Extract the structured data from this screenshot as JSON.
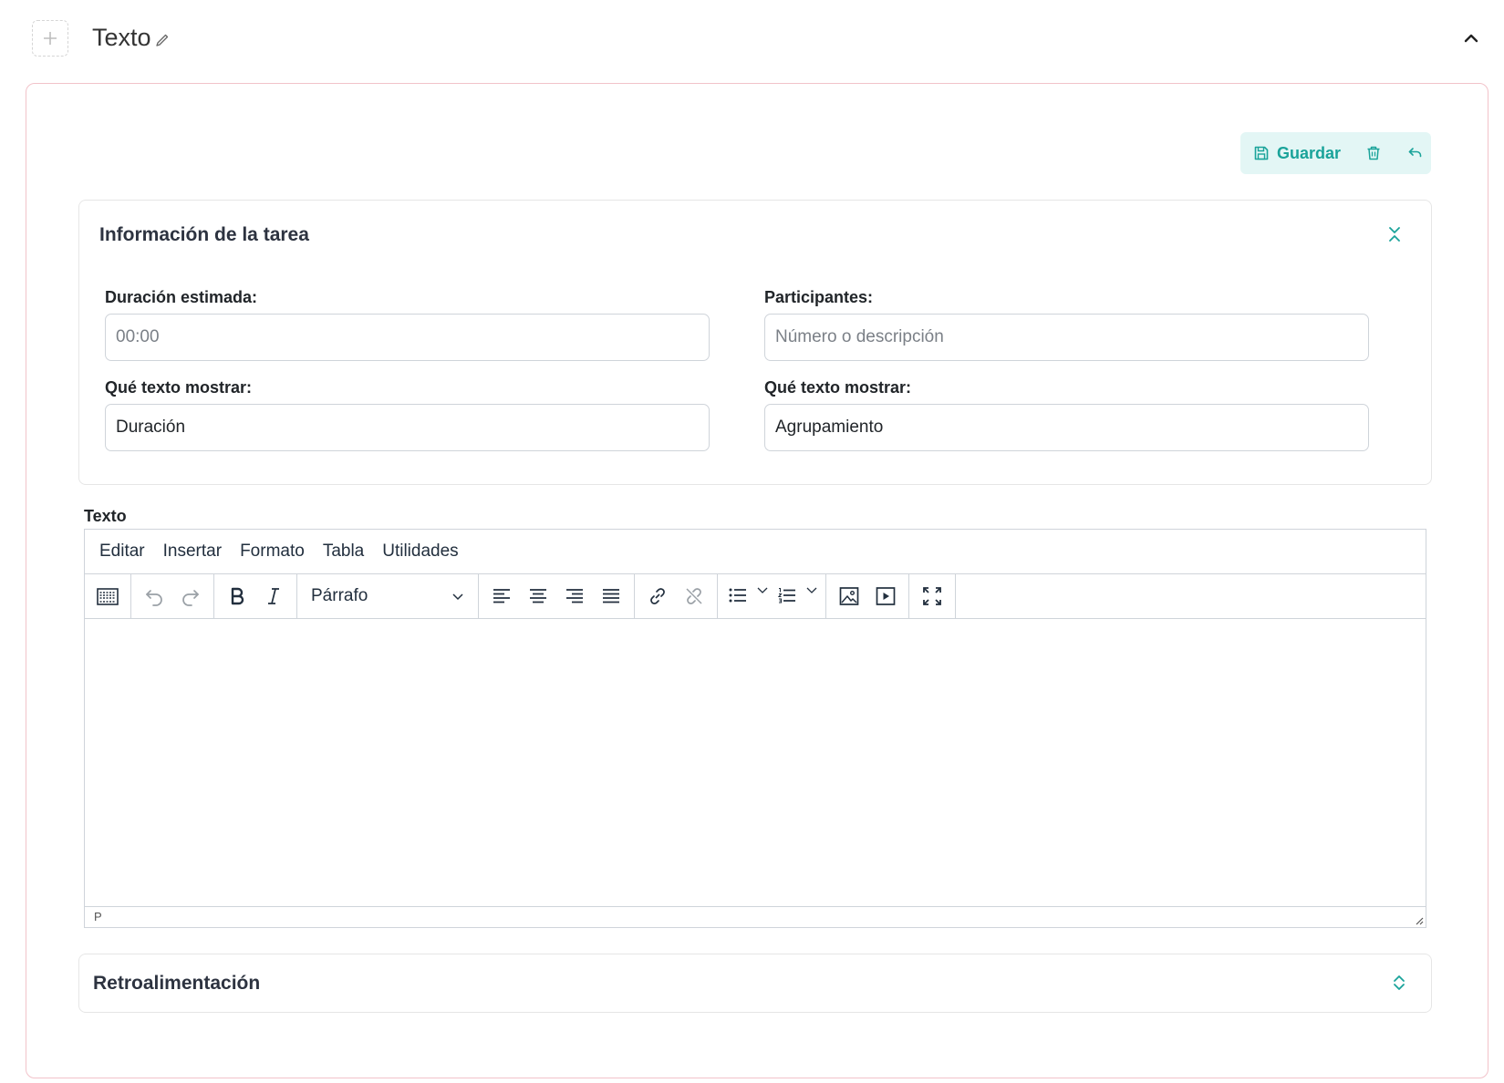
{
  "header": {
    "title": "Texto",
    "icons": {
      "add": "plus-icon",
      "edit": "pencil-icon",
      "collapse": "chevron-up-icon"
    }
  },
  "actions": {
    "save_label": "Guardar",
    "icons": {
      "save": "floppy-disk-icon",
      "delete": "trash-icon",
      "undo": "undo-arrow-icon"
    }
  },
  "task_info": {
    "title": "Información de la tarea",
    "toggle_icon": "chevrons-collapse-icon",
    "duration": {
      "label": "Duración estimada:",
      "placeholder": "00:00",
      "value": ""
    },
    "participants": {
      "label": "Participantes:",
      "placeholder": "Número o descripción",
      "value": ""
    },
    "duration_display": {
      "label": "Qué texto mostrar:",
      "value": "Duración"
    },
    "participants_display": {
      "label": "Qué texto mostrar:",
      "value": "Agrupamiento"
    }
  },
  "editor": {
    "label": "Texto",
    "menu": [
      "Editar",
      "Insertar",
      "Formato",
      "Tabla",
      "Utilidades"
    ],
    "block_format": "Párrafo",
    "statusbar_path": "P",
    "content": "",
    "toolbar_icons": [
      "keyboard-icon",
      "undo-icon",
      "redo-icon",
      "bold-icon",
      "italic-icon",
      "align-left-icon",
      "align-center-icon",
      "align-right-icon",
      "align-justify-icon",
      "link-icon",
      "unlink-icon",
      "bullet-list-icon",
      "numbered-list-icon",
      "image-icon",
      "media-icon",
      "fullscreen-icon"
    ]
  },
  "feedback": {
    "title": "Retroalimentación",
    "toggle_icon": "chevrons-expand-icon"
  },
  "colors": {
    "accent": "#1aa39a",
    "accent_bg": "#e3f6f5",
    "card_border": "#f2c3ca",
    "panel_border": "#e6e6e6",
    "input_border": "#cfd4da"
  }
}
